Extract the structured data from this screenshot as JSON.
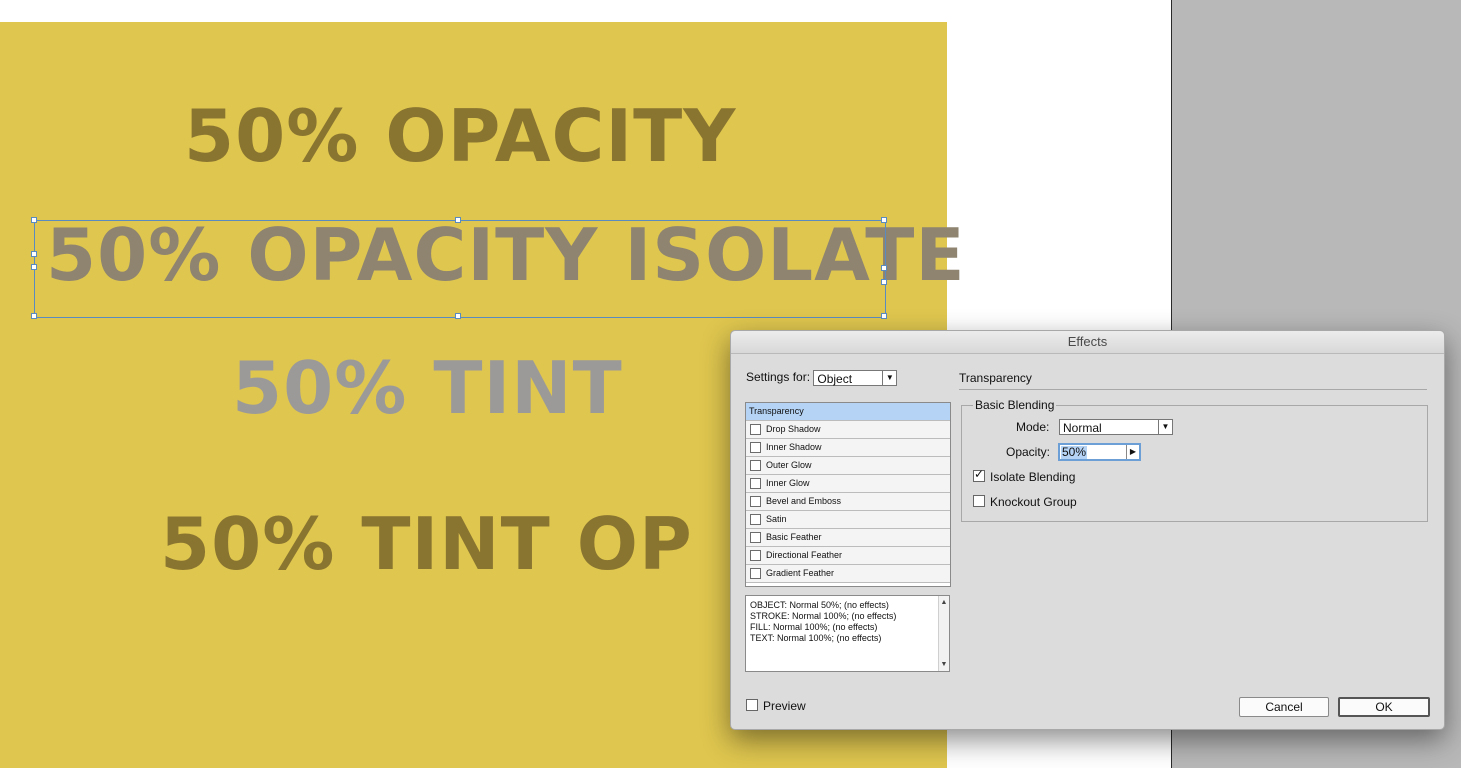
{
  "canvas": {
    "lines": [
      "50% OPACITY",
      "50% OPACITY ISOLATE",
      "50% TINT",
      "50% TINT OP"
    ],
    "colors": {
      "page_fill": "#dfc64f",
      "pasteboard": "#b8b8b8",
      "selection": "#5a8bc0"
    }
  },
  "dialog": {
    "title": "Effects",
    "settings_for_label": "Settings for:",
    "settings_for_value": "Object",
    "effects": [
      {
        "label": "Transparency",
        "checked": null,
        "selected": true
      },
      {
        "label": "Drop Shadow",
        "checked": false
      },
      {
        "label": "Inner Shadow",
        "checked": false
      },
      {
        "label": "Outer Glow",
        "checked": false
      },
      {
        "label": "Inner Glow",
        "checked": false
      },
      {
        "label": "Bevel and Emboss",
        "checked": false
      },
      {
        "label": "Satin",
        "checked": false
      },
      {
        "label": "Basic Feather",
        "checked": false
      },
      {
        "label": "Directional Feather",
        "checked": false
      },
      {
        "label": "Gradient Feather",
        "checked": false
      }
    ],
    "summary": [
      "OBJECT: Normal 50%; (no effects)",
      "STROKE: Normal 100%; (no effects)",
      "FILL: Normal 100%; (no effects)",
      "TEXT: Normal 100%; (no effects)"
    ],
    "section_title": "Transparency",
    "basic_blending": {
      "legend": "Basic Blending",
      "mode_label": "Mode:",
      "mode_value": "Normal",
      "opacity_label": "Opacity:",
      "opacity_value": "50%",
      "isolate_label": "Isolate Blending",
      "isolate_checked": true,
      "knockout_label": "Knockout Group",
      "knockout_checked": false
    },
    "preview_label": "Preview",
    "cancel_label": "Cancel",
    "ok_label": "OK"
  }
}
